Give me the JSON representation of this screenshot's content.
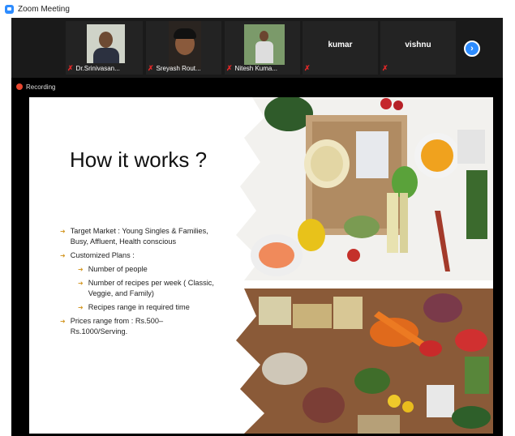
{
  "window": {
    "title": "Zoom Meeting",
    "icon": "zoom-logo-icon"
  },
  "participants": [
    {
      "name": "Dr.Srinivasan...",
      "muted": true,
      "video": true
    },
    {
      "name": "Sreyash Rout...",
      "muted": true,
      "video": true
    },
    {
      "name": "Nitesh Kuma...",
      "muted": true,
      "video": true
    },
    {
      "name": "kumar",
      "muted": true,
      "video": false
    },
    {
      "name": "vishnu",
      "muted": true,
      "video": false
    }
  ],
  "controls": {
    "next_icon": "chevron-right-icon",
    "next_glyph": "›"
  },
  "recording": {
    "label": "Recording",
    "color": "#e8462f"
  },
  "slide": {
    "title": "How it works ?",
    "bullets": {
      "target_market": "Target Market : Young Singles & Families, Busy, Affluent, Health conscious",
      "customized_plans": "Customized Plans :",
      "sub_people": "Number of people",
      "sub_recipes": "Number of recipes per week ( Classic, Veggie, and Family)",
      "sub_range": "Recipes range in required time",
      "prices": "Prices range from : Rs.500– Rs.1000/Serving."
    }
  },
  "colors": {
    "accent": "#2d8cff",
    "muted_mic": "#e02828",
    "bullet_arrow": "#d49a2a"
  }
}
